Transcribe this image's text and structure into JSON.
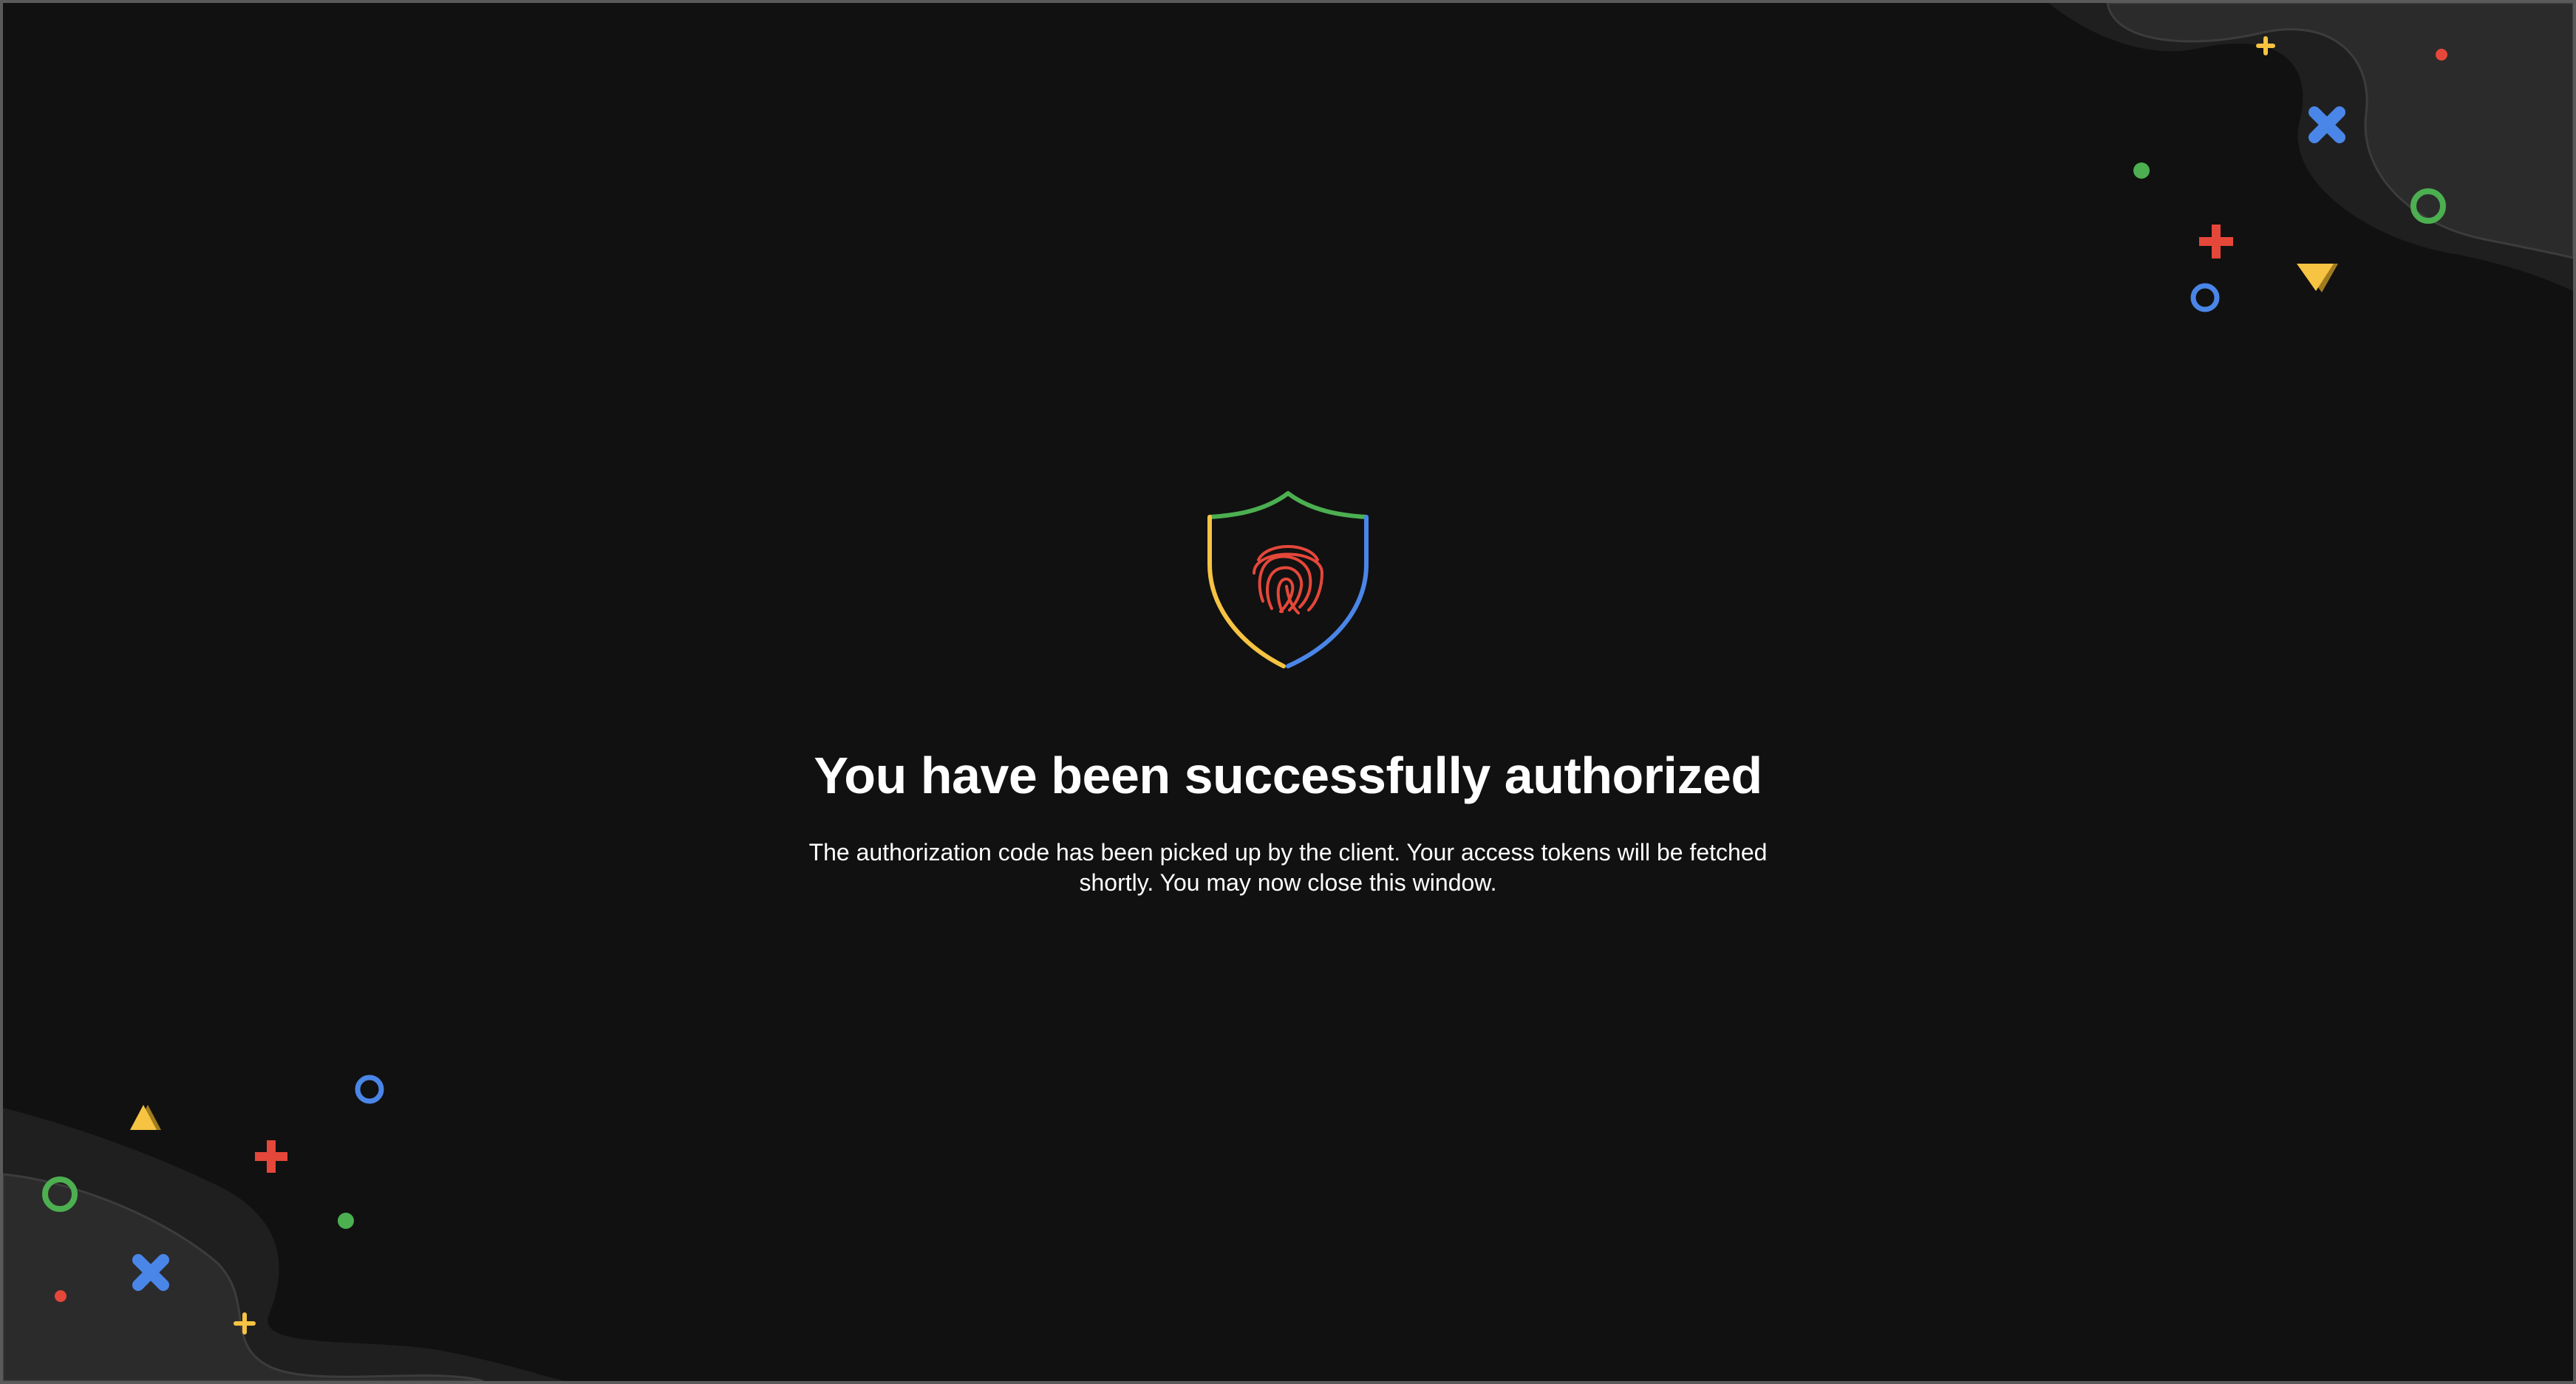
{
  "auth": {
    "title": "You have been successfully authorized",
    "message": "The authorization code has been picked up by the client. Your access tokens will be fetched shortly. You may now close this window."
  },
  "icons": {
    "shield": "shield-fingerprint-icon"
  },
  "colors": {
    "background": "#111111",
    "wave": "#2a2a2a",
    "green": "#4caf50",
    "blue": "#4a86e8",
    "red": "#e5473a",
    "yellow": "#f6c342"
  }
}
